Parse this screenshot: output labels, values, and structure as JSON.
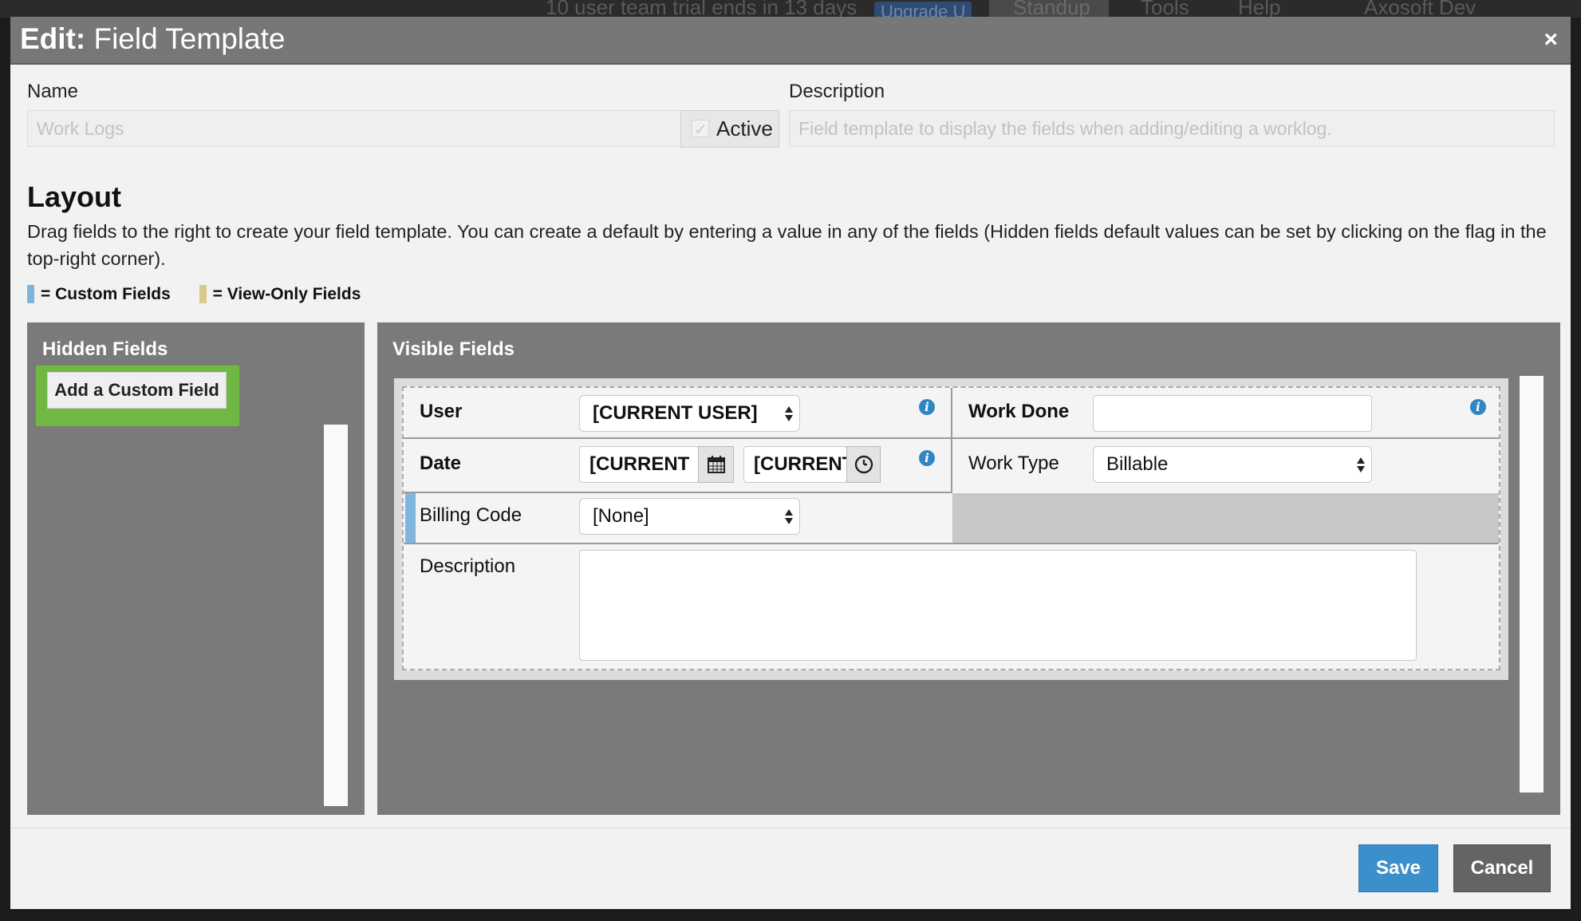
{
  "background": {
    "trial_text": "10 user team trial ends in 13 days",
    "upgrade_label": "Upgrade U",
    "standup_label": "Standup",
    "tools_label": "Tools",
    "help_label": "Help",
    "user_label": "Axosoft Dev"
  },
  "modal": {
    "title_prefix": "Edit:",
    "title": "Field Template",
    "close_glyph": "×"
  },
  "form": {
    "name_label": "Name",
    "name_value": "Work Logs",
    "active_label": "Active",
    "description_label": "Description",
    "description_value": "Field template to display the fields when adding/editing a worklog."
  },
  "layout": {
    "title": "Layout",
    "description": "Drag fields to the right to create your field template. You can create a default by entering a value in any of the fields (Hidden fields default values can be set by clicking on the flag in the top-right corner).",
    "legend": [
      {
        "label": "= Custom Fields",
        "color": "#7fb5dc"
      },
      {
        "label": "= View-Only Fields",
        "color": "#d8c98c"
      }
    ]
  },
  "hidden_fields": {
    "title": "Hidden Fields",
    "add_button": "Add a Custom Field"
  },
  "visible_fields": {
    "title": "Visible Fields",
    "user_label": "User",
    "user_value": "[CURRENT USER]",
    "work_done_label": "Work Done",
    "work_done_value": "",
    "date_label": "Date",
    "date_value": "[CURRENT",
    "time_value": "[CURRENT",
    "work_type_label": "Work Type",
    "work_type_value": "Billable",
    "billing_code_label": "Billing Code",
    "billing_code_value": "[None]",
    "description_label": "Description",
    "description_value": ""
  },
  "footer": {
    "save_label": "Save",
    "cancel_label": "Cancel"
  }
}
